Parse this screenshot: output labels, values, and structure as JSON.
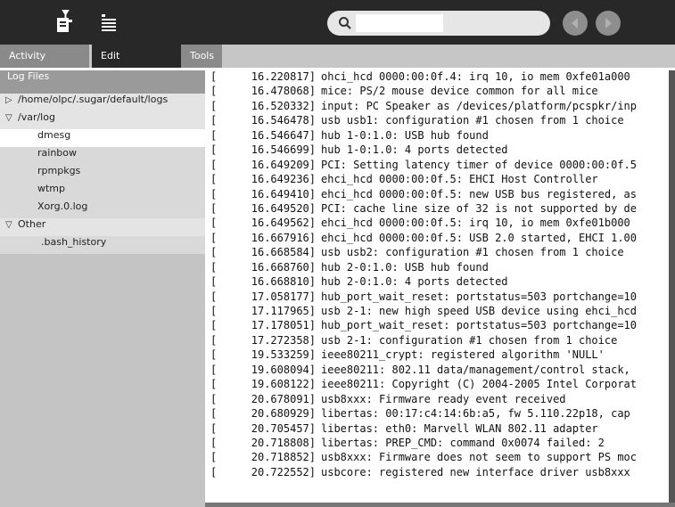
{
  "search": {
    "placeholder": ""
  },
  "toolbar": {
    "activity_icon": "log-activity-icon",
    "edit_icon": "list-icon",
    "back_icon": "back-arrow-icon",
    "forward_icon": "forward-arrow-icon"
  },
  "tabs": [
    {
      "label": "Activity"
    },
    {
      "label": "Edit"
    },
    {
      "label": "Tools"
    }
  ],
  "sidebar": {
    "header": "Log Files",
    "items": [
      {
        "label": "/home/olpc/.sugar/default/logs",
        "type": "folder",
        "expanded": false
      },
      {
        "label": "/var/log",
        "type": "folder",
        "expanded": true
      },
      {
        "label": "dmesg",
        "type": "file",
        "selected": true
      },
      {
        "label": "rainbow",
        "type": "file"
      },
      {
        "label": "rpmpkgs",
        "type": "file"
      },
      {
        "label": "wtmp",
        "type": "file"
      },
      {
        "label": "Xorg.0.log",
        "type": "file"
      },
      {
        "label": "Other",
        "type": "folder",
        "expanded": true
      },
      {
        "label": ".bash_history",
        "type": "file"
      }
    ]
  },
  "log": {
    "lines": [
      {
        "time": "16.220817]",
        "msg": "ohci_hcd 0000:00:0f.4: irq 10, io mem 0xfe01a000"
      },
      {
        "time": "16.478068]",
        "msg": "mice: PS/2 mouse device common for all mice"
      },
      {
        "time": "16.520332]",
        "msg": "input: PC Speaker as /devices/platform/pcspkr/inp"
      },
      {
        "time": "16.546478]",
        "msg": "usb usb1: configuration #1 chosen from 1 choice"
      },
      {
        "time": "16.546647]",
        "msg": "hub 1-0:1.0: USB hub found"
      },
      {
        "time": "16.546699]",
        "msg": "hub 1-0:1.0: 4 ports detected"
      },
      {
        "time": "16.649209]",
        "msg": "PCI: Setting latency timer of device 0000:00:0f.5"
      },
      {
        "time": "16.649236]",
        "msg": "ehci_hcd 0000:00:0f.5: EHCI Host Controller"
      },
      {
        "time": "16.649410]",
        "msg": "ehci_hcd 0000:00:0f.5: new USB bus registered, as"
      },
      {
        "time": "16.649520]",
        "msg": "PCI: cache line size of 32 is not supported by de"
      },
      {
        "time": "16.649562]",
        "msg": "ehci_hcd 0000:00:0f.5: irq 10, io mem 0xfe01b000"
      },
      {
        "time": "16.667916]",
        "msg": "ehci_hcd 0000:00:0f.5: USB 2.0 started, EHCI 1.00"
      },
      {
        "time": "16.668584]",
        "msg": "usb usb2: configuration #1 chosen from 1 choice"
      },
      {
        "time": "16.668760]",
        "msg": "hub 2-0:1.0: USB hub found"
      },
      {
        "time": "16.668810]",
        "msg": "hub 2-0:1.0: 4 ports detected"
      },
      {
        "time": "17.058177]",
        "msg": "hub_port_wait_reset: portstatus=503 portchange=10"
      },
      {
        "time": "17.117965]",
        "msg": "usb 2-1: new high speed USB device using ehci_hcd"
      },
      {
        "time": "17.178051]",
        "msg": "hub_port_wait_reset: portstatus=503 portchange=10"
      },
      {
        "time": "17.272358]",
        "msg": "usb 2-1: configuration #1 chosen from 1 choice"
      },
      {
        "time": "19.533259]",
        "msg": "ieee80211_crypt: registered algorithm 'NULL'"
      },
      {
        "time": "19.608094]",
        "msg": "ieee80211: 802.11 data/management/control stack,"
      },
      {
        "time": "19.608122]",
        "msg": "ieee80211: Copyright (C) 2004-2005 Intel Corporat"
      },
      {
        "time": "20.678091]",
        "msg": "usb8xxx: Firmware ready event received"
      },
      {
        "time": "20.680929]",
        "msg": "libertas: 00:17:c4:14:6b:a5, fw 5.110.22p18, cap"
      },
      {
        "time": "20.705457]",
        "msg": "libertas: eth0: Marvell WLAN 802.11 adapter"
      },
      {
        "time": "20.718808]",
        "msg": "libertas: PREP_CMD: command 0x0074 failed: 2"
      },
      {
        "time": "20.718852]",
        "msg": "usb8xxx: Firmware does not seem to support PS moc"
      },
      {
        "time": "20.722552]",
        "msg": "usbcore: registered new interface driver usb8xxx"
      }
    ]
  }
}
